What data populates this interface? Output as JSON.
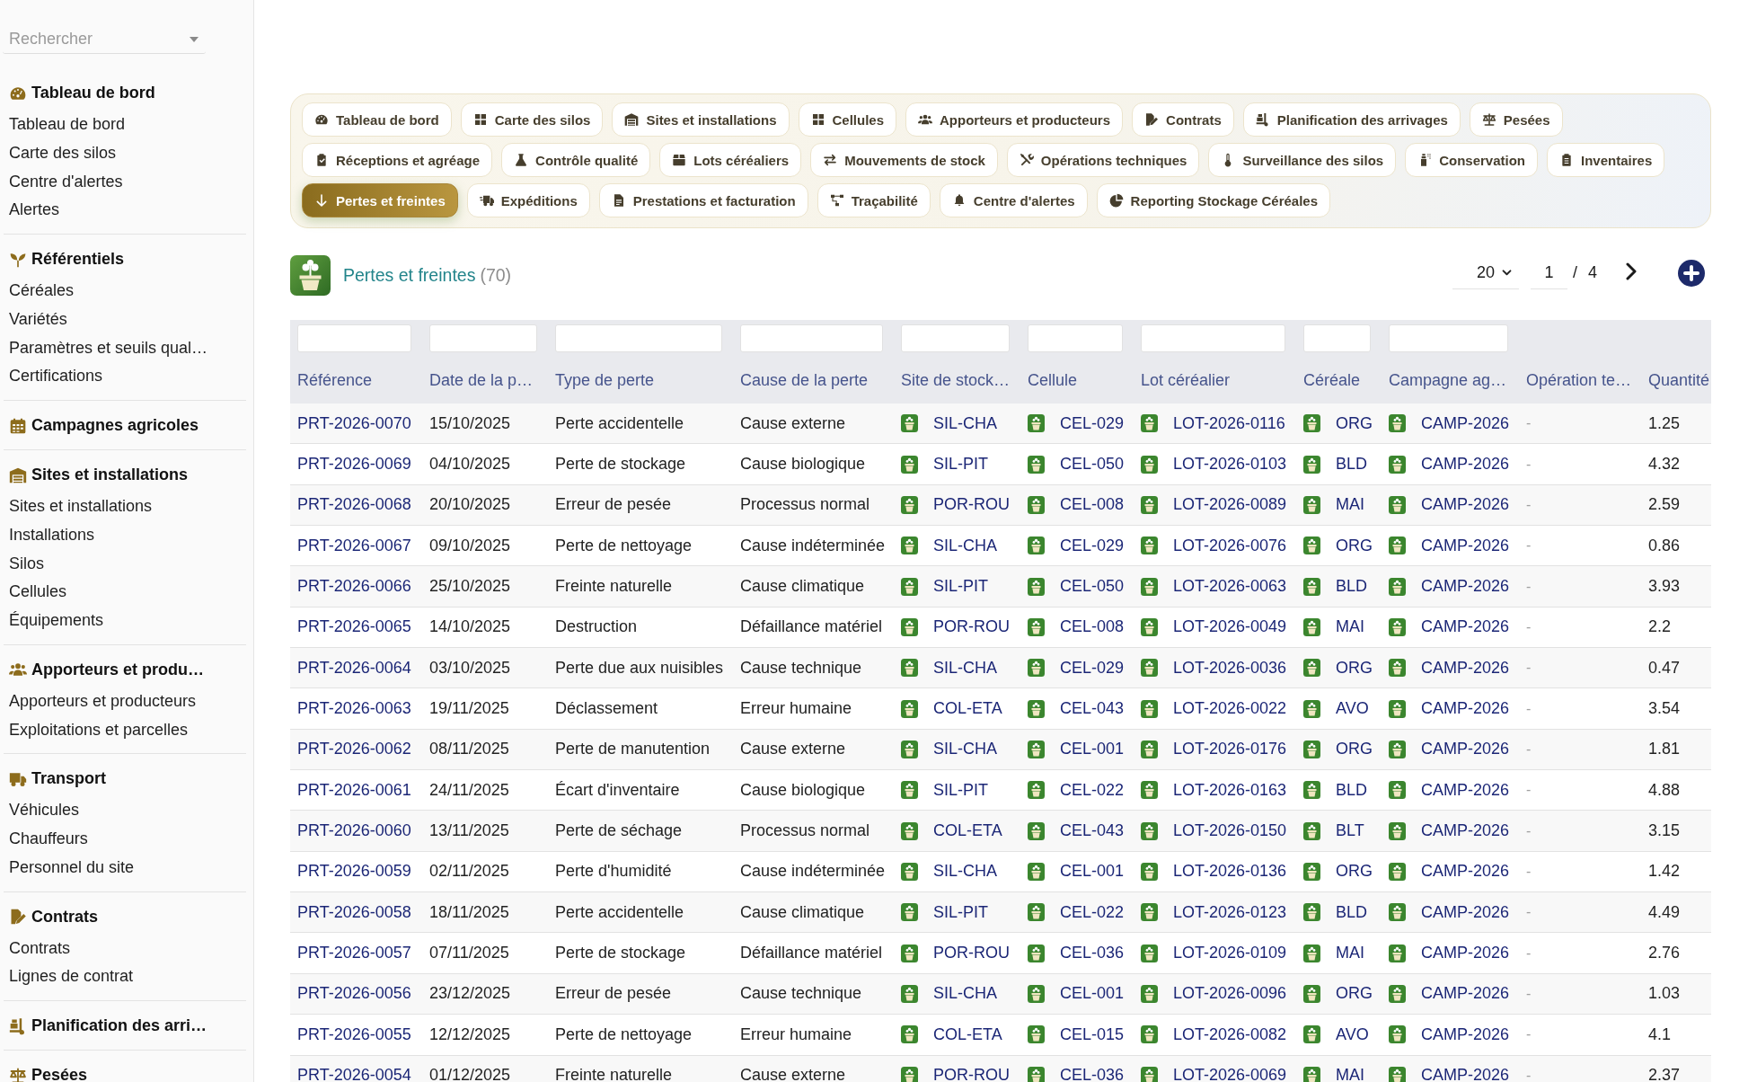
{
  "sidebar": {
    "search": {
      "placeholder": "Rechercher"
    },
    "sections": [
      {
        "title": "Tableau de bord",
        "items": [
          "Tableau de bord",
          "Carte des silos",
          "Centre d'alertes",
          "Alertes"
        ]
      },
      {
        "title": "Référentiels",
        "items": [
          "Céréales",
          "Variétés",
          "Paramètres et seuils qual…",
          "Certifications"
        ]
      },
      {
        "title": "Campagnes agricoles"
      },
      {
        "title": "Sites et installations",
        "items": [
          "Sites et installations",
          "Installations",
          "Silos",
          "Cellules",
          "Équipements"
        ]
      },
      {
        "title": "Apporteurs et produ…",
        "items": [
          "Apporteurs et producteurs",
          "Exploitations et parcelles"
        ]
      },
      {
        "title": "Transport",
        "items": [
          "Véhicules",
          "Chauffeurs",
          "Personnel du site"
        ]
      },
      {
        "title": "Contrats",
        "items": [
          "Contrats",
          "Lignes de contrat"
        ]
      },
      {
        "title": "Planification des arri…"
      },
      {
        "title": "Pesées"
      }
    ]
  },
  "module_tabs": [
    {
      "label": "Tableau de bord",
      "selected": false
    },
    {
      "label": "Carte des silos",
      "selected": false
    },
    {
      "label": "Sites et installations",
      "selected": false
    },
    {
      "label": "Cellules",
      "selected": false
    },
    {
      "label": "Apporteurs et producteurs",
      "selected": false
    },
    {
      "label": "Contrats",
      "selected": false
    },
    {
      "label": "Planification des arrivages",
      "selected": false
    },
    {
      "label": "Pesées",
      "selected": false
    },
    {
      "label": "Réceptions et agréage",
      "selected": false
    },
    {
      "label": "Contrôle qualité",
      "selected": false
    },
    {
      "label": "Lots céréaliers",
      "selected": false
    },
    {
      "label": "Mouvements de stock",
      "selected": false
    },
    {
      "label": "Opérations techniques",
      "selected": false
    },
    {
      "label": "Surveillance des silos",
      "selected": false
    },
    {
      "label": "Conservation",
      "selected": false
    },
    {
      "label": "Inventaires",
      "selected": false
    },
    {
      "label": "Pertes et freintes",
      "selected": true
    },
    {
      "label": "Expéditions",
      "selected": false
    },
    {
      "label": "Prestations et facturation",
      "selected": false
    },
    {
      "label": "Traçabilité",
      "selected": false
    },
    {
      "label": "Centre d'alertes",
      "selected": false
    },
    {
      "label": "Reporting Stockage Céréales",
      "selected": false
    }
  ],
  "page_header": {
    "title": "Pertes et freintes",
    "count": "(70)"
  },
  "pagination": {
    "page_size": "20",
    "page": "1",
    "separator": "/",
    "total_pages": "4"
  },
  "table": {
    "columns": [
      {
        "label": "Référence",
        "kind": "reference",
        "filter": true
      },
      {
        "label": "Date de la p…",
        "kind": "text",
        "filter": true
      },
      {
        "label": "Type de perte",
        "kind": "text",
        "filter": true
      },
      {
        "label": "Cause de la perte",
        "kind": "text",
        "filter": true
      },
      {
        "label": "Site de stock…",
        "kind": "linked",
        "filter": true
      },
      {
        "label": "Cellule",
        "kind": "linked",
        "filter": true
      },
      {
        "label": "Lot céréalier",
        "kind": "linked",
        "filter": true
      },
      {
        "label": "Céréale",
        "kind": "linked",
        "filter": true
      },
      {
        "label": "Campagne ag…",
        "kind": "linked",
        "filter": true
      },
      {
        "label": "Opération te…",
        "kind": "empty",
        "filter": false
      },
      {
        "label": "Quantité",
        "kind": "number",
        "filter": false
      }
    ],
    "rows": [
      [
        "PRT-2026-0070",
        "15/10/2025",
        "Perte accidentelle",
        "Cause externe",
        "SIL-CHA",
        "CEL-029",
        "LOT-2026-0116",
        "ORG",
        "CAMP-2026",
        "-",
        "1.25"
      ],
      [
        "PRT-2026-0069",
        "04/10/2025",
        "Perte de stockage",
        "Cause biologique",
        "SIL-PIT",
        "CEL-050",
        "LOT-2026-0103",
        "BLD",
        "CAMP-2026",
        "-",
        "4.32"
      ],
      [
        "PRT-2026-0068",
        "20/10/2025",
        "Erreur de pesée",
        "Processus normal",
        "POR-ROU",
        "CEL-008",
        "LOT-2026-0089",
        "MAI",
        "CAMP-2026",
        "-",
        "2.59"
      ],
      [
        "PRT-2026-0067",
        "09/10/2025",
        "Perte de nettoyage",
        "Cause indéterminée",
        "SIL-CHA",
        "CEL-029",
        "LOT-2026-0076",
        "ORG",
        "CAMP-2026",
        "-",
        "0.86"
      ],
      [
        "PRT-2026-0066",
        "25/10/2025",
        "Freinte naturelle",
        "Cause climatique",
        "SIL-PIT",
        "CEL-050",
        "LOT-2026-0063",
        "BLD",
        "CAMP-2026",
        "-",
        "3.93"
      ],
      [
        "PRT-2026-0065",
        "14/10/2025",
        "Destruction",
        "Défaillance matériel",
        "POR-ROU",
        "CEL-008",
        "LOT-2026-0049",
        "MAI",
        "CAMP-2026",
        "-",
        "2.2"
      ],
      [
        "PRT-2026-0064",
        "03/10/2025",
        "Perte due aux nuisibles",
        "Cause technique",
        "SIL-CHA",
        "CEL-029",
        "LOT-2026-0036",
        "ORG",
        "CAMP-2026",
        "-",
        "0.47"
      ],
      [
        "PRT-2026-0063",
        "19/11/2025",
        "Déclassement",
        "Erreur humaine",
        "COL-ETA",
        "CEL-043",
        "LOT-2026-0022",
        "AVO",
        "CAMP-2026",
        "-",
        "3.54"
      ],
      [
        "PRT-2026-0062",
        "08/11/2025",
        "Perte de manutention",
        "Cause externe",
        "SIL-CHA",
        "CEL-001",
        "LOT-2026-0176",
        "ORG",
        "CAMP-2026",
        "-",
        "1.81"
      ],
      [
        "PRT-2026-0061",
        "24/11/2025",
        "Écart d'inventaire",
        "Cause biologique",
        "SIL-PIT",
        "CEL-022",
        "LOT-2026-0163",
        "BLD",
        "CAMP-2026",
        "-",
        "4.88"
      ],
      [
        "PRT-2026-0060",
        "13/11/2025",
        "Perte de séchage",
        "Processus normal",
        "COL-ETA",
        "CEL-043",
        "LOT-2026-0150",
        "BLT",
        "CAMP-2026",
        "-",
        "3.15"
      ],
      [
        "PRT-2026-0059",
        "02/11/2025",
        "Perte d'humidité",
        "Cause indéterminée",
        "SIL-CHA",
        "CEL-001",
        "LOT-2026-0136",
        "ORG",
        "CAMP-2026",
        "-",
        "1.42"
      ],
      [
        "PRT-2026-0058",
        "18/11/2025",
        "Perte accidentelle",
        "Cause climatique",
        "SIL-PIT",
        "CEL-022",
        "LOT-2026-0123",
        "BLD",
        "CAMP-2026",
        "-",
        "4.49"
      ],
      [
        "PRT-2026-0057",
        "07/11/2025",
        "Perte de stockage",
        "Défaillance matériel",
        "POR-ROU",
        "CEL-036",
        "LOT-2026-0109",
        "MAI",
        "CAMP-2026",
        "-",
        "2.76"
      ],
      [
        "PRT-2026-0056",
        "23/12/2025",
        "Erreur de pesée",
        "Cause technique",
        "SIL-CHA",
        "CEL-001",
        "LOT-2026-0096",
        "ORG",
        "CAMP-2026",
        "-",
        "1.03"
      ],
      [
        "PRT-2026-0055",
        "12/12/2025",
        "Perte de nettoyage",
        "Erreur humaine",
        "COL-ETA",
        "CEL-015",
        "LOT-2026-0082",
        "AVO",
        "CAMP-2026",
        "-",
        "4.1"
      ],
      [
        "PRT-2026-0054",
        "01/12/2025",
        "Freinte naturelle",
        "Cause externe",
        "POR-ROU",
        "CEL-036",
        "LOT-2026-0069",
        "MAI",
        "CAMP-2026",
        "-",
        "2.37"
      ]
    ]
  }
}
